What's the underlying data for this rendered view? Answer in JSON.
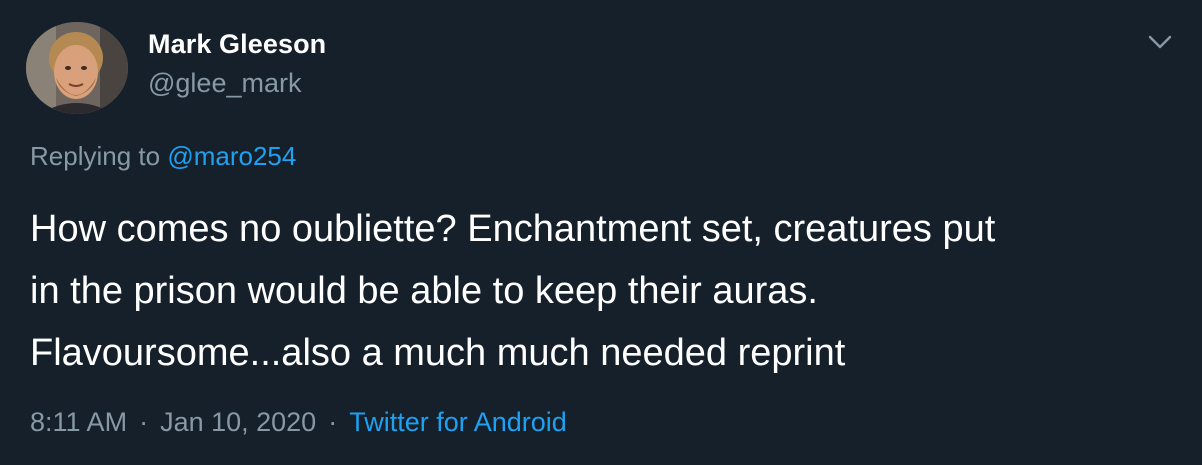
{
  "tweet": {
    "author": {
      "name": "Mark Gleeson",
      "handle": "@glee_mark"
    },
    "reply": {
      "prefix": "Replying to",
      "mention": "@maro254"
    },
    "text_lines": [
      "How comes no oubliette? Enchantment set, creatures put",
      "in the prison would be able to keep their auras.",
      "Flavoursome...also a much much needed reprint"
    ],
    "time": "8:11 AM",
    "separator": "·",
    "date": "Jan 10, 2020",
    "source": "Twitter for Android",
    "more_icon": "chevron-down-icon"
  },
  "colors": {
    "background": "#15202b",
    "text": "#ffffff",
    "secondary": "#8899a6",
    "accent": "#1da1f2"
  }
}
